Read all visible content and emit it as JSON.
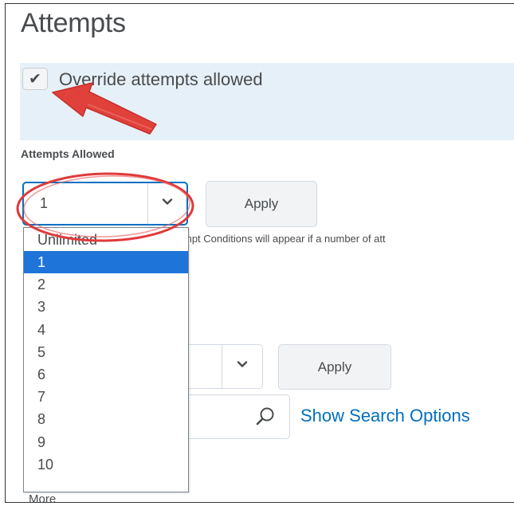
{
  "section": {
    "title": "Attempts"
  },
  "override": {
    "label": "Override attempts allowed",
    "checked": true
  },
  "attempts_allowed": {
    "label": "Attempts Allowed",
    "selected_value": "1",
    "apply_label": "Apply",
    "helper_text": "mpt Conditions will appear if a number of att"
  },
  "dropdown": {
    "options": [
      "Unlimited",
      "1",
      "2",
      "3",
      "4",
      "5",
      "6",
      "7",
      "8",
      "9",
      "10"
    ],
    "selected_index": 1
  },
  "second_row": {
    "apply_label": "Apply"
  },
  "search": {
    "show_options_label": "Show Search Options"
  },
  "footer": {
    "more_label": "More"
  },
  "colors": {
    "accent": "#006fbf",
    "selected_option": "#1e74d8",
    "panel": "#e6f0f8",
    "annotation_red": "#e03a3a"
  }
}
